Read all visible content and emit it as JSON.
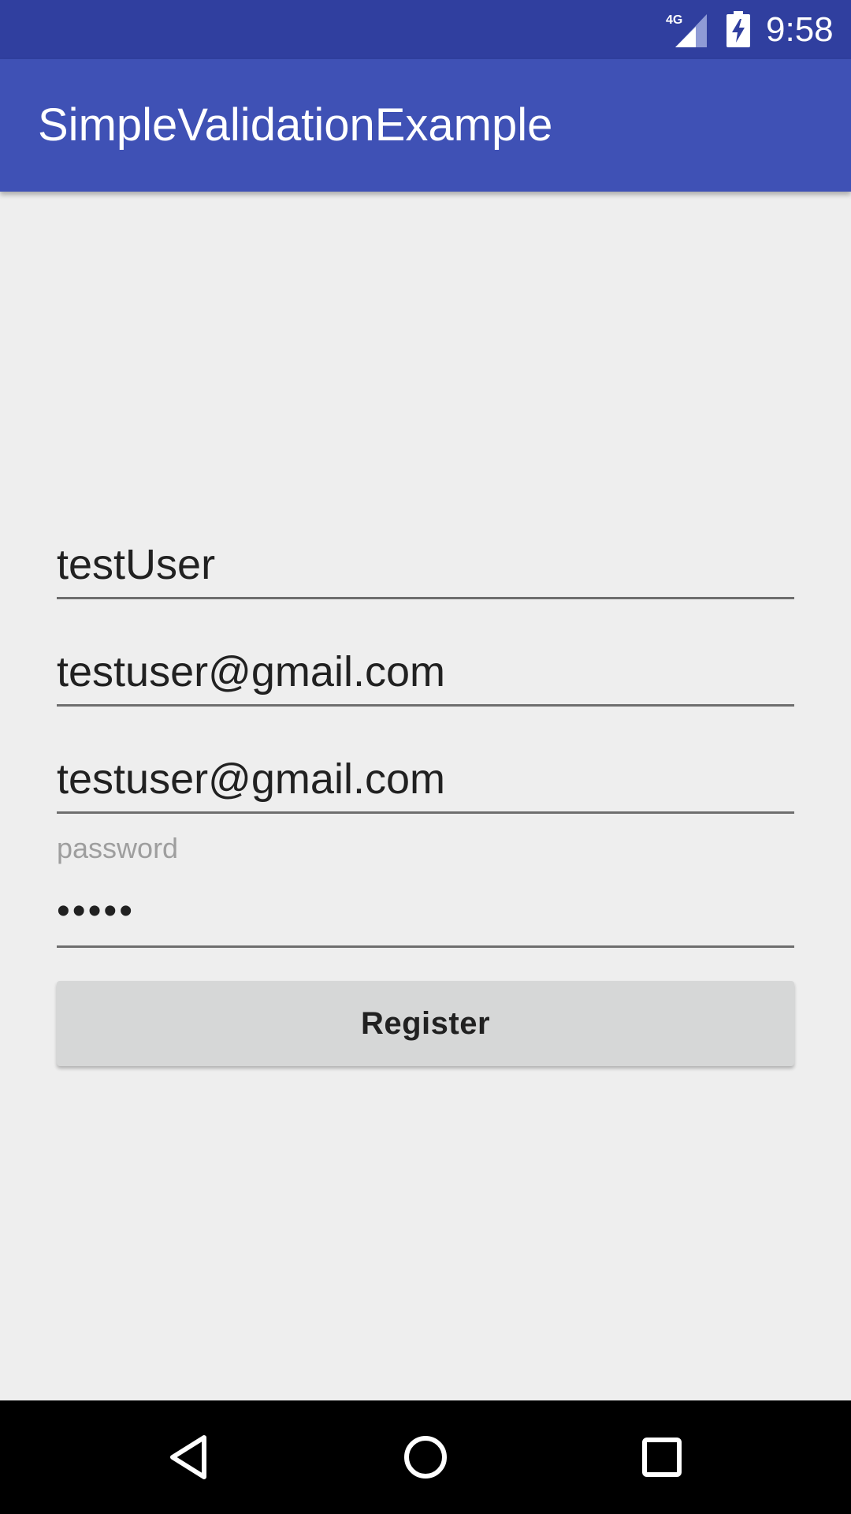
{
  "status_bar": {
    "network_type": "4G",
    "time": "9:58",
    "icons": [
      "cell-signal-icon",
      "battery-charging-icon"
    ]
  },
  "app_bar": {
    "title": "SimpleValidationExample"
  },
  "form": {
    "username": {
      "value": "testUser"
    },
    "email": {
      "value": "testuser@gmail.com"
    },
    "email_confirm": {
      "value": "testuser@gmail.com"
    },
    "password": {
      "label": "password",
      "masked_value": "•••••"
    },
    "register_label": "Register"
  },
  "nav_bar": {
    "icons": [
      "back-icon",
      "home-icon",
      "recents-icon"
    ]
  },
  "colors": {
    "status_bar": "#303f9f",
    "app_bar": "#3f51b5",
    "background": "#eeeeee",
    "button": "#d6d7d7",
    "nav_bar": "#000000"
  }
}
